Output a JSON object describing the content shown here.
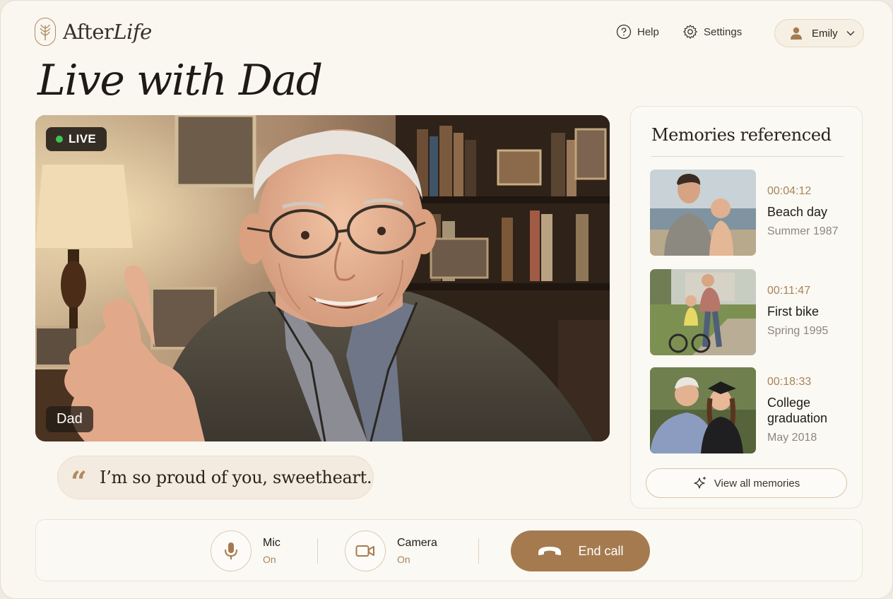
{
  "app": {
    "brand_prefix": "After",
    "brand_suffix": "Life"
  },
  "header": {
    "help_label": "Help",
    "settings_label": "Settings",
    "user_name": "Emily"
  },
  "page": {
    "title": "Live with Dad"
  },
  "video": {
    "live_label": "LIVE",
    "name_label": "Dad",
    "live_color": "#3cc552"
  },
  "quote": {
    "mark": "“",
    "text": "I’m so proud of you, sweetheart."
  },
  "memories": {
    "title": "Memories referenced",
    "items": [
      {
        "time": "00:04:12",
        "title": "Beach day",
        "date": "Summer 1987"
      },
      {
        "time": "00:11:47",
        "title": "First bike",
        "date": "Spring 1995"
      },
      {
        "time": "00:18:33",
        "title": "College graduation",
        "date": "May 2018"
      }
    ],
    "view_all_label": "View all memories"
  },
  "controls": {
    "mic": {
      "label": "Mic",
      "state": "On"
    },
    "camera": {
      "label": "Camera",
      "state": "On"
    },
    "end_call_label": "End call"
  },
  "colors": {
    "accent": "#a67a4f",
    "accent_text": "#a8845a",
    "background": "#faf7f1"
  }
}
